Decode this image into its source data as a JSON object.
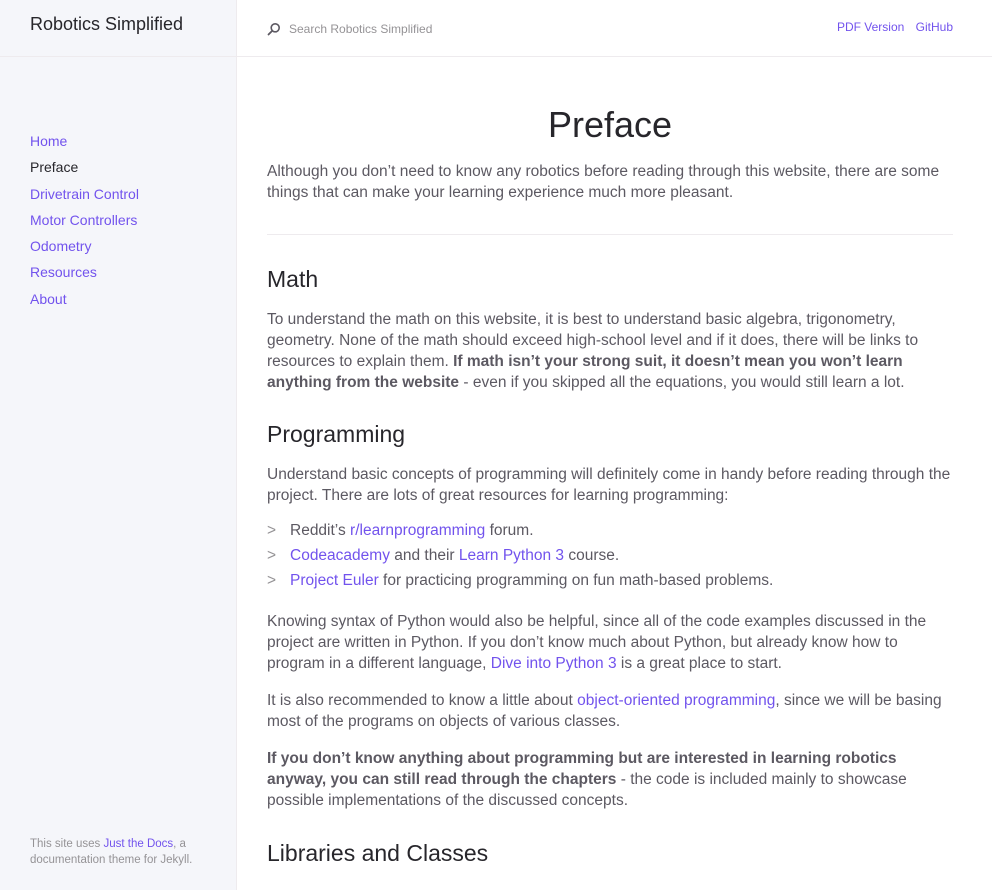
{
  "site": {
    "title": "Robotics Simplified"
  },
  "nav": [
    {
      "label": "Home",
      "active": false
    },
    {
      "label": "Preface",
      "active": true
    },
    {
      "label": "Drivetrain Control",
      "active": false
    },
    {
      "label": "Motor Controllers",
      "active": false
    },
    {
      "label": "Odometry",
      "active": false
    },
    {
      "label": "Resources",
      "active": false
    },
    {
      "label": "About",
      "active": false
    }
  ],
  "footer": {
    "before": "This site uses ",
    "link": "Just the Docs",
    "after": ", a documentation theme for Jekyll."
  },
  "search": {
    "placeholder": "Search Robotics Simplified",
    "icon": "search-icon"
  },
  "aux_links": [
    "PDF Version",
    "GitHub"
  ],
  "colors": {
    "link": "#7253ed",
    "text": "#5c5962",
    "heading": "#27262b",
    "sidebar_bg": "#f5f6fa"
  },
  "content": {
    "title": "Preface",
    "intro": "Although you don’t need to know any robotics before reading through this website, there are some things that can make your learning experience much more pleasant.",
    "math": {
      "heading": "Math",
      "text": "To understand the math on this website, it is best to understand basic algebra, trigonometry, geometry. None of the math should exceed high-school level and if it does, there will be links to resources to explain them. ",
      "bold": "If math isn’t your strong suit, it doesn’t mean you won’t learn anything from the website",
      "tail": " - even if you skipped all the equations, you would still learn a lot."
    },
    "programming": {
      "heading": "Programming",
      "intro": "Understand basic concepts of programming will definitely come in handy before reading through the project. There are lots of great resources for learning programming:",
      "bullet": ">",
      "list": {
        "item1_pre": "Reddit’s ",
        "item1_link": "r/learnprogramming",
        "item1_post": " forum.",
        "item2_link": "Codeacademy",
        "item2_mid": " and their ",
        "item2_link2": "Learn Python 3",
        "item2_post": " course.",
        "item3_link": "Project Euler",
        "item3_post": " for practicing programming on fun math-based problems."
      },
      "p2_pre": "Knowing syntax of Python would also be helpful, since all of the code examples discussed in the project are written in Python. If you don’t know much about Python, but already know how to program in a different language, ",
      "p2_link": "Dive into Python 3",
      "p2_post": " is a great place to start.",
      "p3_pre": "It is also recommended to know a little about ",
      "p3_link": "object-oriented programming",
      "p3_post": ", since we will be basing most of the programs on objects of various classes.",
      "p4_bold": "If you don’t know anything about programming but are interested in learning robotics anyway, you can still read through the chapters",
      "p4_post": " - the code is included mainly to showcase possible implementations of the discussed concepts."
    },
    "libraries": {
      "heading": "Libraries and Classes"
    }
  }
}
